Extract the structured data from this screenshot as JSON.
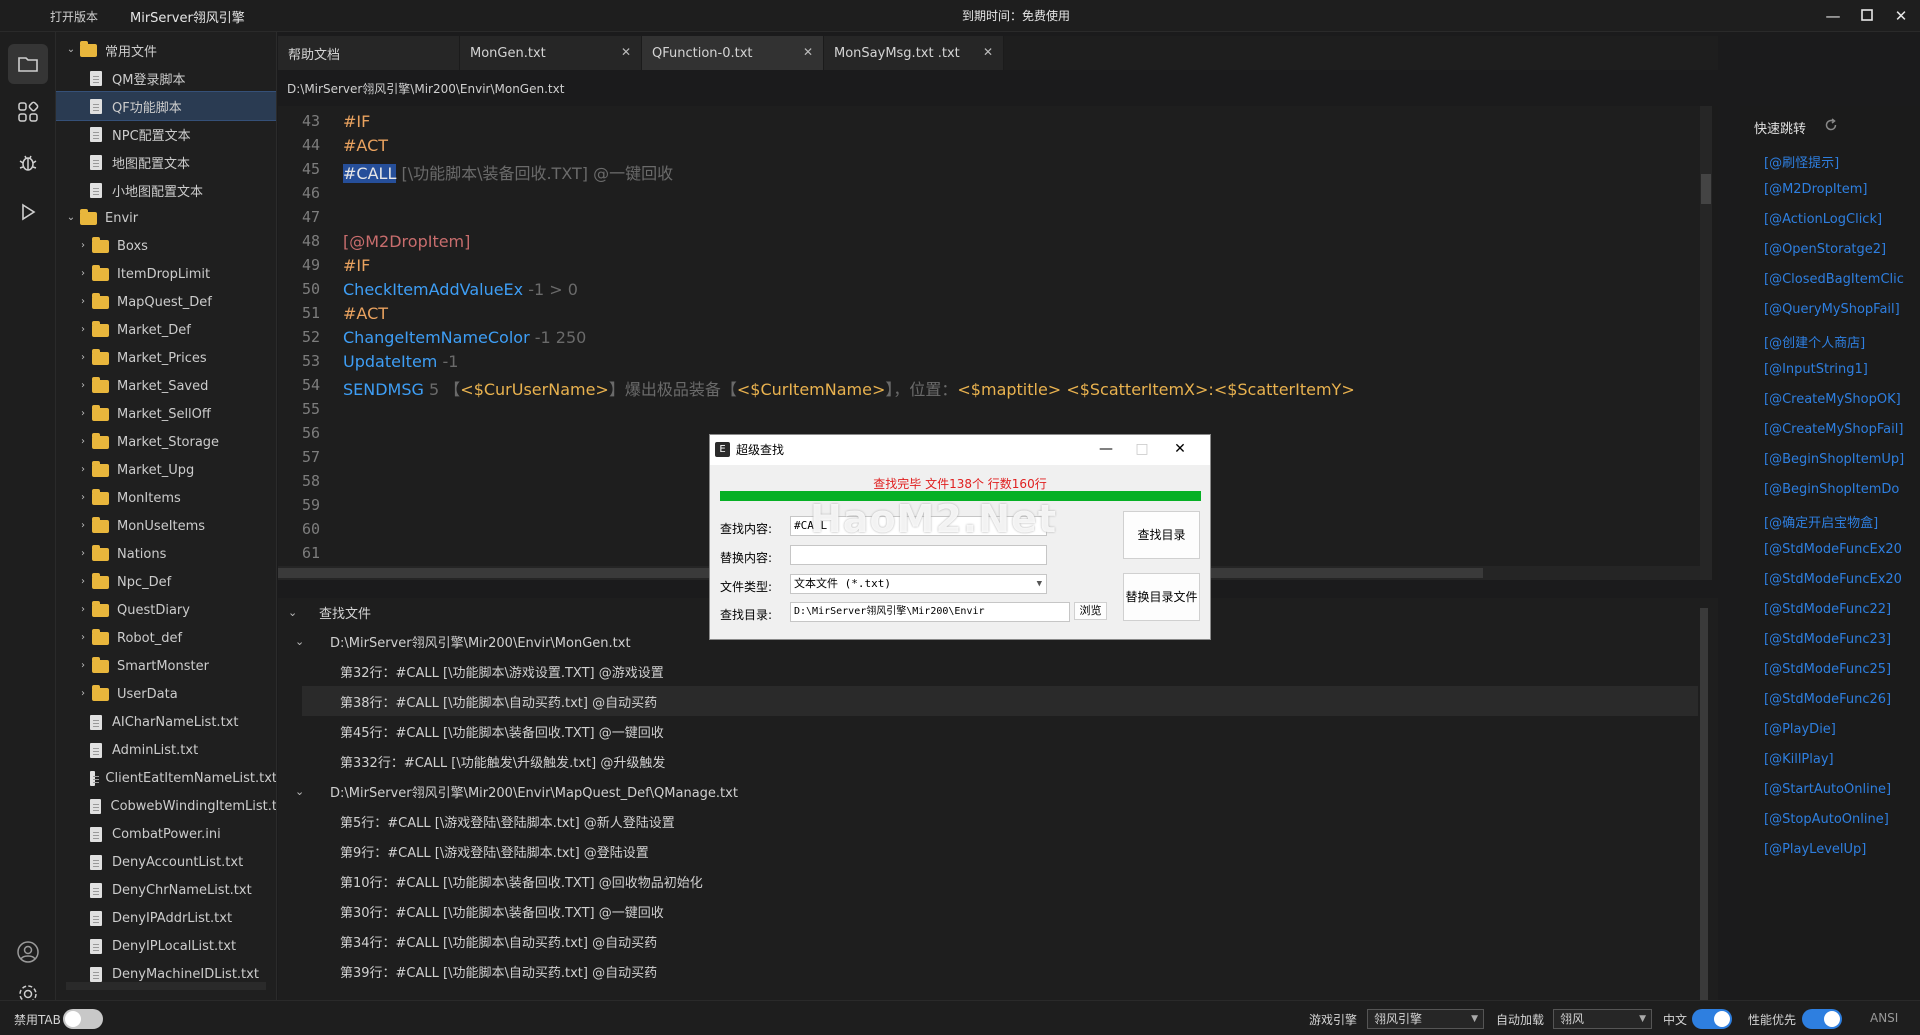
{
  "titlebar": {
    "open_version": "打开版本",
    "app_title": "MirServer翎风引擎",
    "expiry": "到期时间：免费使用"
  },
  "activity": {
    "icons": [
      "files-icon",
      "extensions-icon",
      "debug-icon",
      "run-icon",
      "account-icon",
      "settings-icon"
    ]
  },
  "tree": {
    "items": [
      {
        "label": "常用文件",
        "kind": "folder-open"
      },
      {
        "label": "QM登录脚本",
        "kind": "file"
      },
      {
        "label": "QF功能脚本",
        "kind": "file",
        "selected": true
      },
      {
        "label": "NPC配置文本",
        "kind": "file"
      },
      {
        "label": "地图配置文本",
        "kind": "file"
      },
      {
        "label": "小地图配置文本",
        "kind": "file"
      },
      {
        "label": "Envir",
        "kind": "folder-open"
      },
      {
        "label": "Boxs",
        "kind": "folder"
      },
      {
        "label": "ItemDropLimit",
        "kind": "folder"
      },
      {
        "label": "MapQuest_Def",
        "kind": "folder"
      },
      {
        "label": "Market_Def",
        "kind": "folder"
      },
      {
        "label": "Market_Prices",
        "kind": "folder"
      },
      {
        "label": "Market_Saved",
        "kind": "folder"
      },
      {
        "label": "Market_SellOff",
        "kind": "folder"
      },
      {
        "label": "Market_Storage",
        "kind": "folder"
      },
      {
        "label": "Market_Upg",
        "kind": "folder"
      },
      {
        "label": "MonItems",
        "kind": "folder"
      },
      {
        "label": "MonUseItems",
        "kind": "folder"
      },
      {
        "label": "Nations",
        "kind": "folder"
      },
      {
        "label": "Npc_Def",
        "kind": "folder"
      },
      {
        "label": "QuestDiary",
        "kind": "folder"
      },
      {
        "label": "Robot_def",
        "kind": "folder"
      },
      {
        "label": "SmartMonster",
        "kind": "folder"
      },
      {
        "label": "UserData",
        "kind": "folder"
      },
      {
        "label": "AICharNameList.txt",
        "kind": "file"
      },
      {
        "label": "AdminList.txt",
        "kind": "file"
      },
      {
        "label": "ClientEatItemNameList.txt",
        "kind": "file"
      },
      {
        "label": "CobwebWindingItemList.t",
        "kind": "file"
      },
      {
        "label": "CombatPower.ini",
        "kind": "file"
      },
      {
        "label": "DenyAccountList.txt",
        "kind": "file"
      },
      {
        "label": "DenyChrNameList.txt",
        "kind": "file"
      },
      {
        "label": "DenyIPAddrList.txt",
        "kind": "file"
      },
      {
        "label": "DenyIPLocalList.txt",
        "kind": "file"
      },
      {
        "label": "DenyMachineIDList.txt",
        "kind": "file"
      }
    ]
  },
  "tabs": [
    {
      "label": "帮助文档",
      "closable": false,
      "active": false
    },
    {
      "label": "MonGen.txt",
      "closable": true,
      "active": false
    },
    {
      "label": "QFunction-0.txt",
      "closable": true,
      "active": true
    },
    {
      "label": "MonSayMsg.txt .txt",
      "closable": true,
      "active": false
    }
  ],
  "editor": {
    "path": "D:\\MirServer翎风引擎\\Mir200\\Envir\\MonGen.txt",
    "line_numbers": [
      "43",
      "44",
      "45",
      "46",
      "47",
      "48",
      "49",
      "50",
      "51",
      "52",
      "53",
      "54",
      "55",
      "56",
      "57",
      "58",
      "59",
      "60",
      "61"
    ],
    "l43": "#IF",
    "l44": "#ACT",
    "l45_kw": "#CALL",
    "l45_path": " [\\功能脚本\\装备回收.TXT] @一键回收",
    "l48": "[@M2DropItem]",
    "l49": "#IF",
    "l50_fn": "CheckItemAddValueEx",
    "l50_args": " -1 > 0",
    "l51": "#ACT",
    "l52_fn": "ChangeItemNameColor",
    "l52_args": " -1 250",
    "l53_fn": "UpdateItem",
    "l53_args": " -1",
    "l54_fn": "SENDMSG",
    "l54_a": " 5 【",
    "l54_v1": "<$CurUserName>",
    "l54_b": "】爆出极品装备【",
    "l54_v2": "<$CurItemName>",
    "l54_c": "】，位置：",
    "l54_v3": "<$maptitle>",
    "l54_d": " ",
    "l54_v4": "<$ScatterItemX>",
    "l54_e": ":",
    "l54_v5": "<$ScatterItemY>"
  },
  "results": {
    "header": "查找文件",
    "groups": [
      {
        "file": "D:\\MirServer翎风引擎\\Mir200\\Envir\\MonGen.txt",
        "rows": [
          "第32行：#CALL [\\功能脚本\\游戏设置.TXT] @游戏设置",
          "第38行：#CALL [\\功能脚本\\自动买药.txt] @自动买药",
          "第45行：#CALL [\\功能脚本\\装备回收.TXT] @一键回收",
          "第332行：#CALL [\\功能触发\\升级触发.txt] @升级触发"
        ]
      },
      {
        "file": "D:\\MirServer翎风引擎\\Mir200\\Envir\\MapQuest_Def\\QManage.txt",
        "rows": [
          "第5行：#CALL [\\游戏登陆\\登陆脚本.txt] @新人登陆设置",
          "第9行：#CALL [\\游戏登陆\\登陆脚本.txt] @登陆设置",
          "第10行：#CALL [\\功能脚本\\装备回收.TXT] @回收物品初始化",
          "第30行：#CALL [\\功能脚本\\装备回收.TXT] @一键回收",
          "第34行：#CALL [\\功能脚本\\自动买药.txt] @自动买药",
          "第39行：#CALL [\\功能脚本\\自动买药.txt] @自动买药"
        ]
      }
    ]
  },
  "quick": {
    "title": "快速跳转",
    "items": [
      "[@刷怪提示]",
      "[@M2DropItem]",
      "[@ActionLogClick]",
      "[@OpenStoratge2]",
      "[@ClosedBagItemClic",
      "[@QueryMyShopFail]",
      "[@创建个人商店]",
      "[@InputString1]",
      "[@CreateMyShopOK]",
      "[@CreateMyShopFail]",
      "[@BeginShopItemUp]",
      "[@BeginShopItemDo",
      "[@确定开启宝物盒]",
      "[@StdModeFuncEx20",
      "[@StdModeFuncEx20",
      "[@StdModeFunc22]",
      "[@StdModeFunc23]",
      "[@StdModeFunc25]",
      "[@StdModeFunc26]",
      "[@PlayDie]",
      "[@KillPlay]",
      "[@StartAutoOnline]",
      "[@StopAutoOnline]",
      "[@PlayLevelUp]"
    ]
  },
  "dialog": {
    "title": "超级查找",
    "status": "查找完毕  文件138个  行数160行",
    "progress": 1.0,
    "find_label": "查找内容:",
    "find_value": "#CALL",
    "replace_label": "替换内容:",
    "replace_value": "",
    "type_label": "文件类型:",
    "type_value": "文本文件 (*.txt)",
    "dir_label": "查找目录:",
    "dir_value": "D:\\MirServer翎风引擎\\Mir200\\Envir",
    "browse": "浏览",
    "find_dir_button": "查找目录",
    "replace_dir_button": "替换目录文件",
    "watermark": "HaoM2.Net"
  },
  "statusbar": {
    "disable_tab": "禁用TAB",
    "engine_label": "游戏引擎",
    "engine_value": "翎风引擎",
    "autoload_label": "自动加载",
    "autoload_value": "翎风",
    "chinese_label": "中文",
    "perf_label": "性能优先",
    "encoding": "ANSI",
    "toggle_tab_on": false,
    "toggle_cn_on": true,
    "toggle_perf_on": true
  },
  "colors": {
    "accent": "#2e7fe0",
    "keyword": "#e9a25f",
    "function": "#3e9ef5",
    "label": "#c86d6d",
    "progress": "#06b025",
    "status_red": "#e02020"
  }
}
